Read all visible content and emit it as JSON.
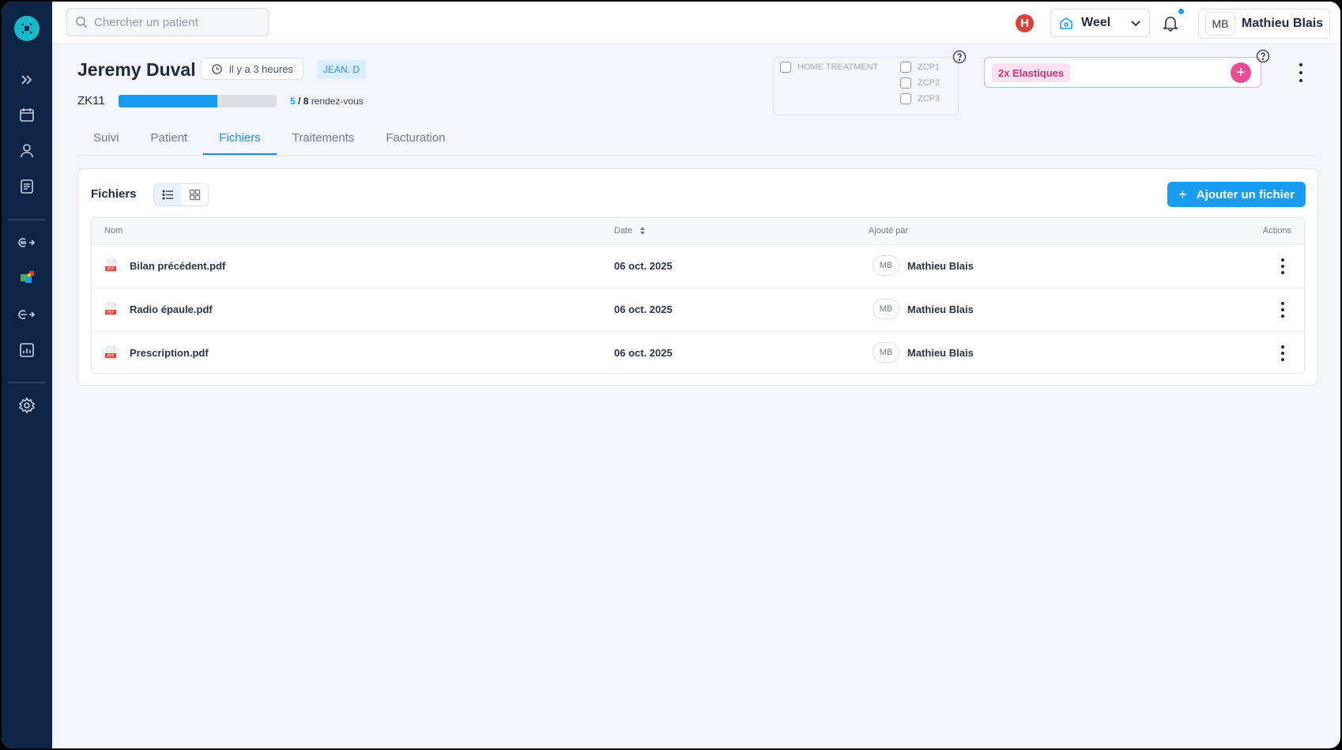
{
  "search": {
    "placeholder": "Chercher un patient"
  },
  "topbar": {
    "h_badge": "H",
    "clinic": "Weel",
    "user_initials": "MB",
    "user_name": "Mathieu Blais"
  },
  "patient": {
    "name": "Jeremy Duval",
    "last_seen": "il y a 3 heures",
    "tag": "JEAN. D",
    "code": "ZK11",
    "appointments_done": "5",
    "appointments_sep": " / ",
    "appointments_total": "8",
    "appointments_label": "rendez-vous",
    "progress_fraction": 0.625
  },
  "home_treatment": {
    "label": "HOME TREATMENT",
    "options": [
      "ZCP1",
      "ZCP2",
      "ZCP3"
    ]
  },
  "tags": [
    "2x Elastiques"
  ],
  "tabs": [
    "Suivi",
    "Patient",
    "Fichiers",
    "Traitements",
    "Facturation"
  ],
  "active_tab": "Fichiers",
  "files": {
    "title": "Fichiers",
    "add_button": "Ajouter un fichier",
    "columns": {
      "name": "Nom",
      "date": "Date",
      "added_by": "Ajouté par",
      "actions": "Actions"
    },
    "rows": [
      {
        "name": "Bilan précédent.pdf",
        "date": "06 oct. 2025",
        "initials": "MB",
        "added_by": "Mathieu Blais"
      },
      {
        "name": "Radio épaule.pdf",
        "date": "06 oct. 2025",
        "initials": "MB",
        "added_by": "Mathieu Blais"
      },
      {
        "name": "Prescription.pdf",
        "date": "06 oct. 2025",
        "initials": "MB",
        "added_by": "Mathieu Blais"
      }
    ]
  },
  "colors": {
    "accent": "#1a9cf0",
    "sidebar": "#0e2446",
    "tag_pink": "#ec4c96",
    "alert_red": "#d8403a"
  },
  "icons": [
    "logo-icon",
    "expand-icon",
    "calendar-icon",
    "user-icon",
    "document-icon",
    "euro-transfer-icon",
    "modules-icon",
    "exchange-icon",
    "chart-icon",
    "settings-icon",
    "search-icon",
    "home-icon",
    "chevron-down-icon",
    "bell-icon",
    "clock-icon",
    "help-icon",
    "plus-icon",
    "more-vertical-icon",
    "list-view-icon",
    "grid-view-icon",
    "pdf-icon",
    "sort-icon"
  ]
}
